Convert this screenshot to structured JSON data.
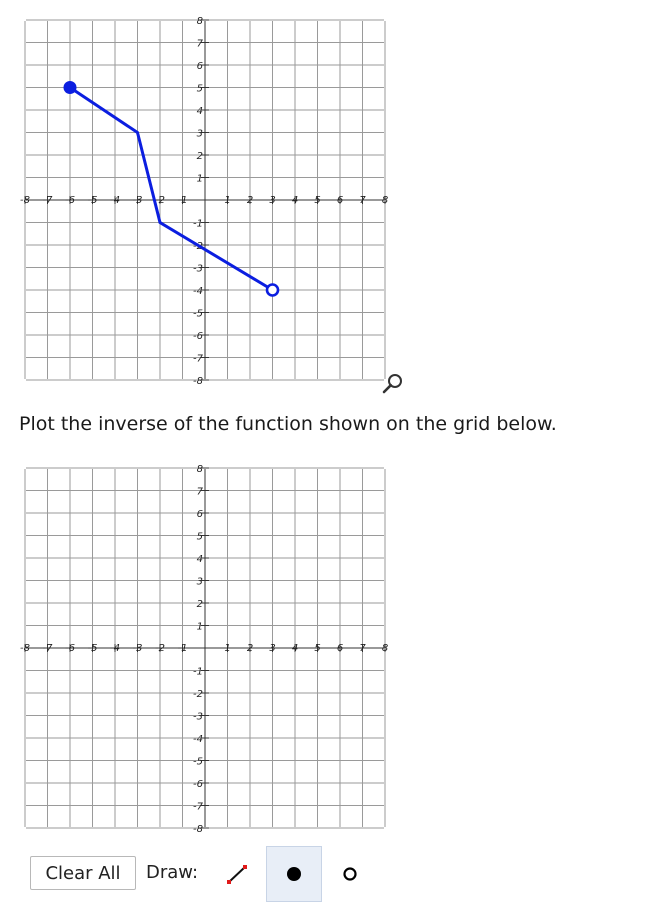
{
  "top_graph": {
    "x_tick_labels": [
      "-8",
      "-7",
      "-6",
      "-5",
      "-4",
      "-3",
      "-2",
      "-1",
      "1",
      "2",
      "3",
      "4",
      "5",
      "6",
      "7",
      "8"
    ],
    "y_tick_labels": [
      "8",
      "7",
      "6",
      "5",
      "4",
      "3",
      "2",
      "1",
      "-1",
      "-2",
      "-3",
      "-4",
      "-5",
      "-6",
      "-7",
      "-8"
    ],
    "function_color": "#0b1ee0",
    "icons": {
      "zoom": "magnifier-icon"
    }
  },
  "prompt": "Plot the inverse of the function shown on the grid below.",
  "bottom_graph": {
    "x_tick_labels": [
      "-8",
      "-7",
      "-6",
      "-5",
      "-4",
      "-3",
      "-2",
      "-1",
      "1",
      "2",
      "3",
      "4",
      "5",
      "6",
      "7",
      "8"
    ],
    "y_tick_labels": [
      "8",
      "7",
      "6",
      "5",
      "4",
      "3",
      "2",
      "1",
      "-1",
      "-2",
      "-3",
      "-4",
      "-5",
      "-6",
      "-7",
      "-8"
    ]
  },
  "toolbar": {
    "clear_label": "Clear All",
    "draw_label": "Draw:",
    "tools": [
      {
        "icon": "line-segment-icon",
        "selected": false
      },
      {
        "icon": "closed-dot-icon",
        "selected": true
      },
      {
        "icon": "open-dot-icon",
        "selected": false
      }
    ]
  },
  "chart_data": {
    "type": "line",
    "xlim": [
      -8,
      8
    ],
    "ylim": [
      -8,
      8
    ],
    "grid": true,
    "series": [
      {
        "x": [
          -6,
          -3,
          -2,
          3
        ],
        "y": [
          5,
          3,
          -1,
          -4
        ],
        "start_point": "closed",
        "end_point": "open"
      }
    ]
  }
}
